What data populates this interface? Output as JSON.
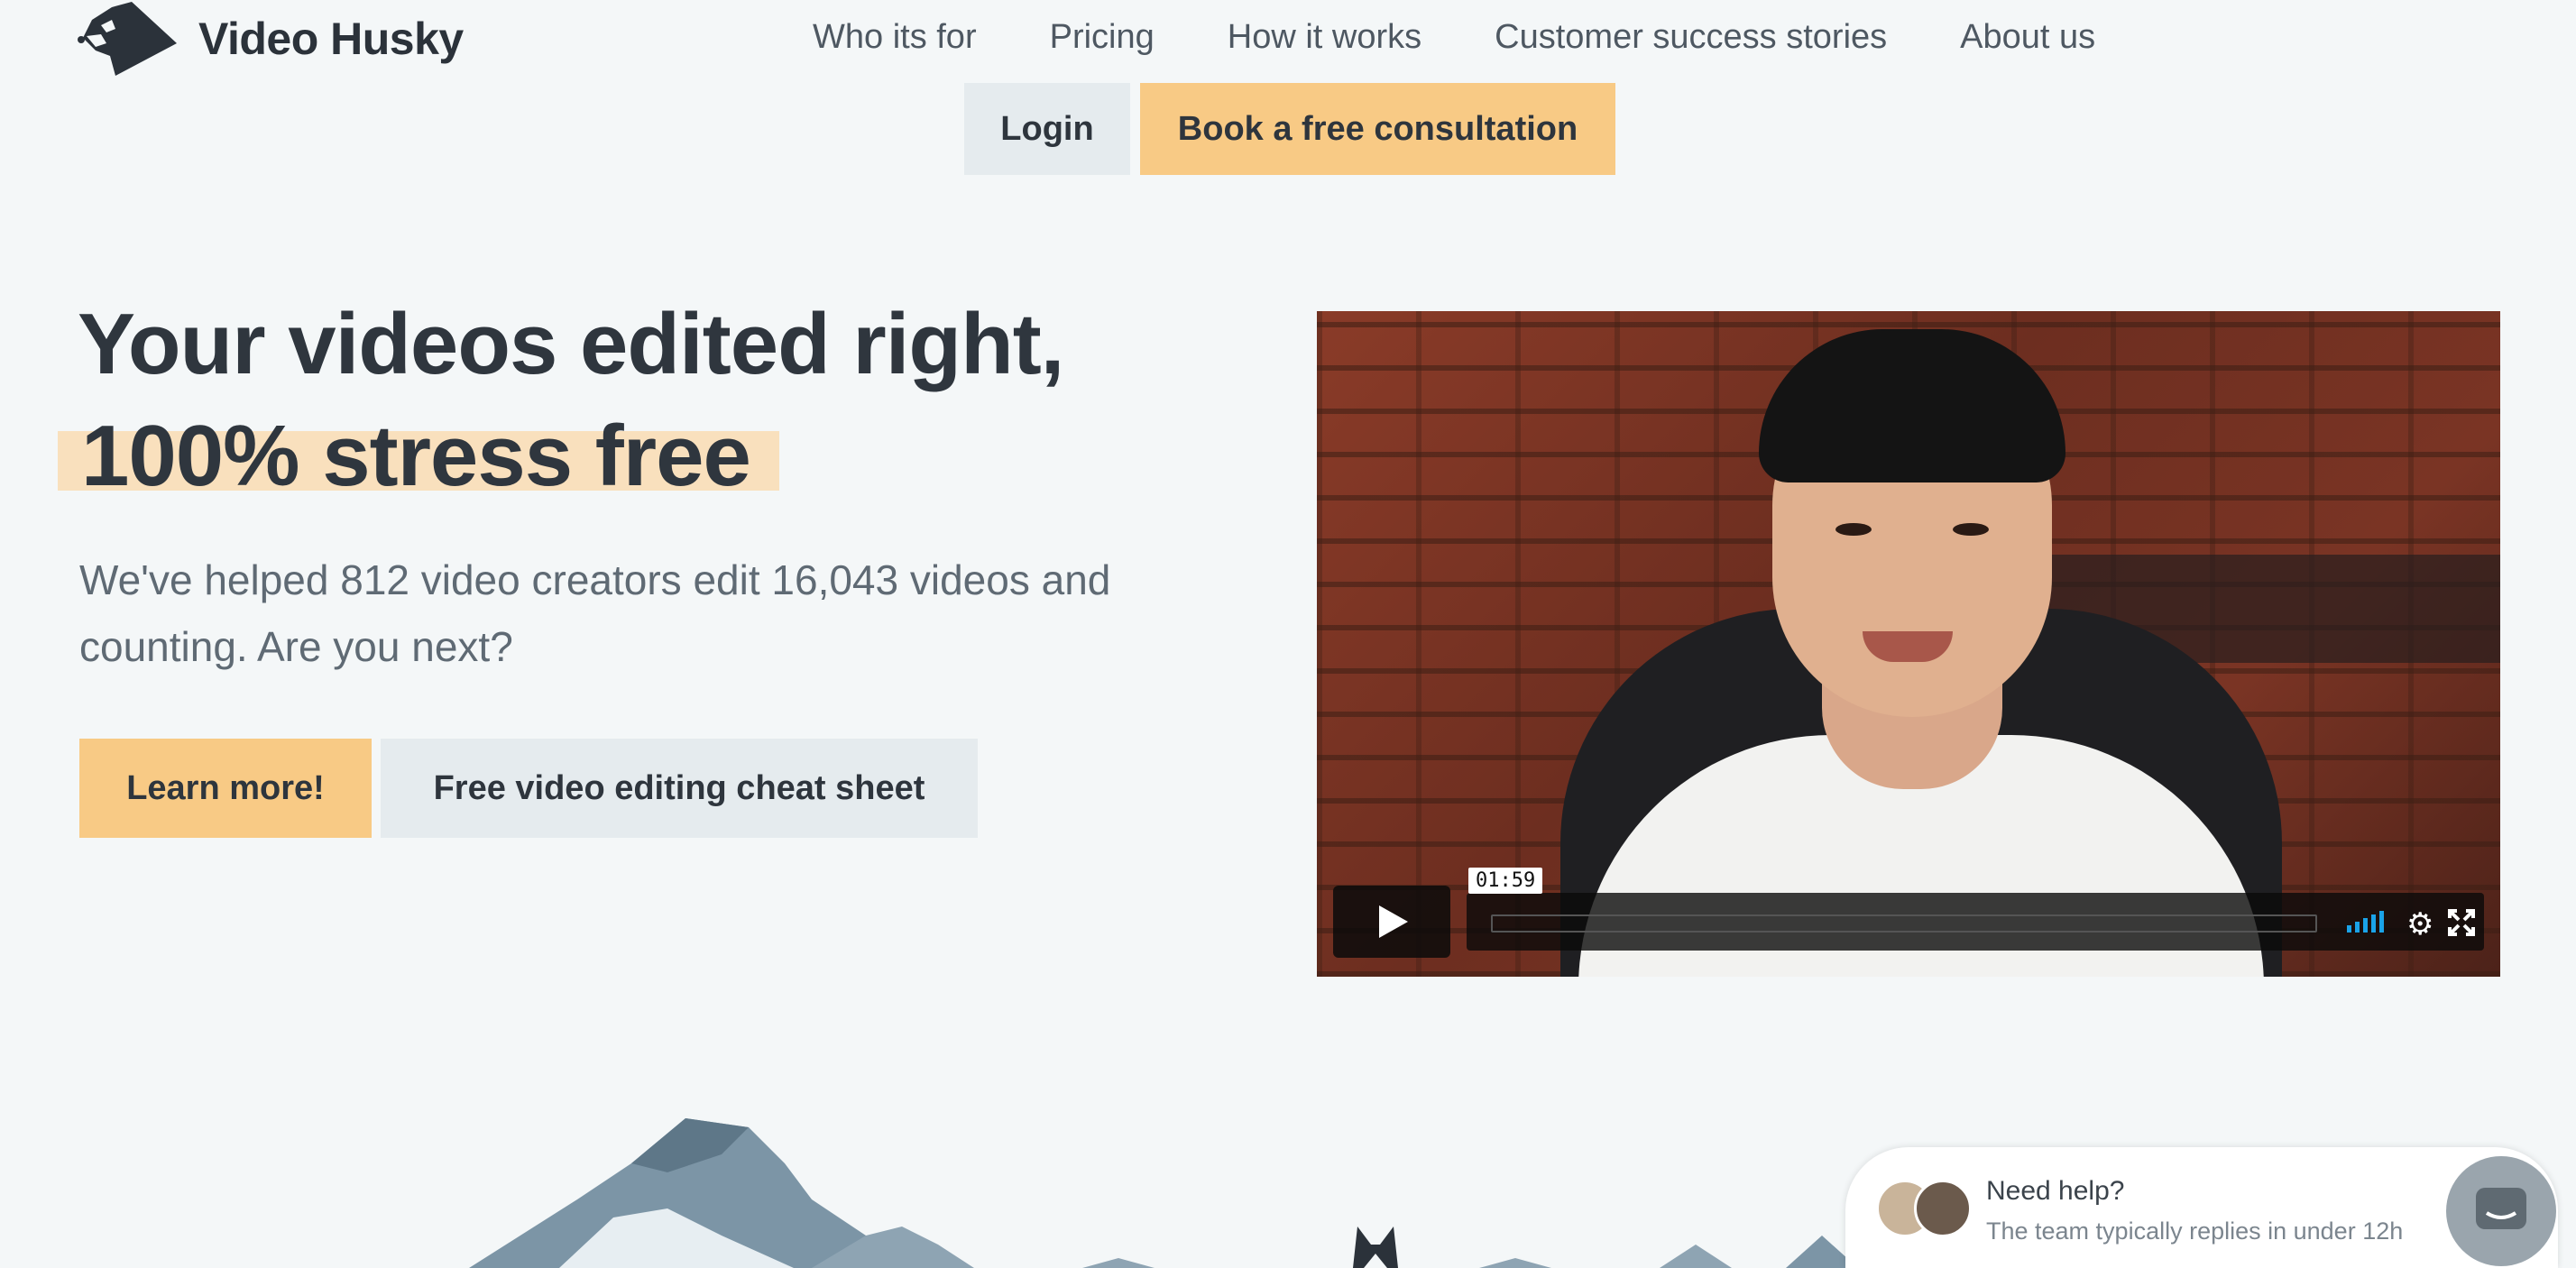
{
  "header": {
    "brand": "Video Husky",
    "nav": [
      {
        "label": "Who its for"
      },
      {
        "label": "Pricing"
      },
      {
        "label": "How it works"
      },
      {
        "label": "Customer success stories"
      },
      {
        "label": "About us"
      }
    ],
    "login_label": "Login",
    "consult_label": "Book a free consultation"
  },
  "hero": {
    "headline_line1": "Your videos edited right,",
    "headline_line2": "100% stress free",
    "subheadline": "We've helped 812 video creators edit 16,043 videos and counting. Are you next?",
    "learn_more_label": "Learn more!",
    "cheat_sheet_label": "Free video editing cheat sheet"
  },
  "video": {
    "duration": "01:59",
    "volume_level": 1.0,
    "progress": 0.0,
    "icons": [
      "play-icon",
      "volume-icon",
      "gear-icon",
      "fullscreen-icon"
    ]
  },
  "help_widget": {
    "title": "Need help?",
    "subtitle": "The team typically replies in under 12h",
    "icon": "chat-icon"
  },
  "colors": {
    "background": "#f4f7f8",
    "accent": "#f8ca85",
    "highlight": "#f9e0bd",
    "secondary_button": "#e5ebee",
    "text_dark": "#2f363e",
    "volume_blue": "#1aa3e8"
  }
}
